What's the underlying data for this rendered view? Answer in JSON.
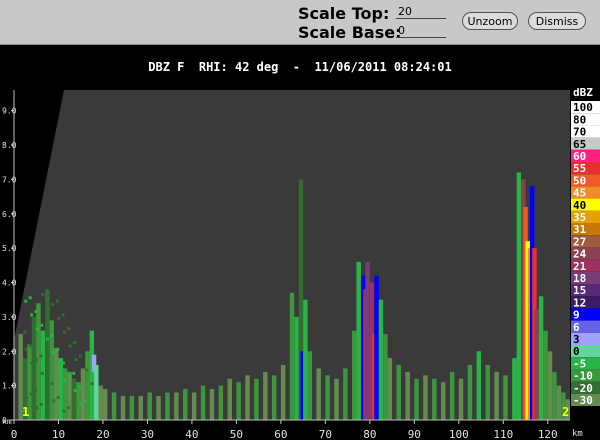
{
  "toolbar": {
    "scale_top_label": "Scale Top:",
    "scale_top_value": "20",
    "scale_base_label": "Scale Base:",
    "scale_base_value": "0",
    "unzoom_label": "Unzoom",
    "dismiss_label": "Dismiss"
  },
  "plot": {
    "title": "DBZ F  RHI: 42 deg  -  11/06/2011 08:24:01",
    "left_marker": "1",
    "right_marker": "2"
  },
  "colors": {
    "background": "#000000",
    "plot_background": "#3a3a3a",
    "toolbar": "#c8c8c8"
  },
  "chart_data": {
    "type": "heatmap",
    "title": "DBZ F  RHI: 42 deg  -  11/06/2011 08:24:01",
    "xlabel": "km",
    "ylabel": "km",
    "xlim": [
      0,
      125
    ],
    "ylim": [
      0,
      9.6
    ],
    "x_ticks": [
      "0",
      "10",
      "20",
      "30",
      "40",
      "50",
      "60",
      "70",
      "80",
      "90",
      "100",
      "110",
      "120"
    ],
    "y_ticks": [
      "0.",
      "1.0",
      "2.0",
      "3.0",
      "4.0",
      "5.0",
      "6.0",
      "7.0",
      "8.0",
      "9.0"
    ],
    "x_unit": "km",
    "y_unit": "km",
    "legend_title": "dBZ",
    "legend_levels": [
      {
        "label": "100",
        "color": "#ffffff"
      },
      {
        "label": "80",
        "color": "#ffffff"
      },
      {
        "label": "70",
        "color": "#ffffff"
      },
      {
        "label": "65",
        "color": "#c8c8c8"
      },
      {
        "label": "60",
        "color": "#ff2080"
      },
      {
        "label": "55",
        "color": "#e83030"
      },
      {
        "label": "50",
        "color": "#f05a28"
      },
      {
        "label": "45",
        "color": "#f08c28"
      },
      {
        "label": "40",
        "color": "#ffff00"
      },
      {
        "label": "35",
        "color": "#e8a000"
      },
      {
        "label": "31",
        "color": "#c87800"
      },
      {
        "label": "27",
        "color": "#a05a3c"
      },
      {
        "label": "24",
        "color": "#8c4050"
      },
      {
        "label": "21",
        "color": "#9c3060"
      },
      {
        "label": "18",
        "color": "#783c78"
      },
      {
        "label": "15",
        "color": "#5a2878"
      },
      {
        "label": "12",
        "color": "#3c1c64"
      },
      {
        "label": "9",
        "color": "#0000ff"
      },
      {
        "label": "6",
        "color": "#6464e6"
      },
      {
        "label": "3",
        "color": "#a0a0ff"
      },
      {
        "label": "0",
        "color": "#64d4a0"
      },
      {
        "label": "-5",
        "color": "#28b446"
      },
      {
        "label": "-10",
        "color": "#3c963c"
      },
      {
        "label": "-20",
        "color": "#326e32"
      },
      {
        "label": "-30",
        "color": "#648c50"
      }
    ],
    "blanking_region": "upper-left",
    "cells": [
      [
        1,
        0,
        2.5,
        "#648c50"
      ],
      [
        2,
        0,
        1.8,
        "#326e32"
      ],
      [
        3,
        0,
        2.2,
        "#3c963c"
      ],
      [
        4,
        0,
        3.0,
        "#326e32"
      ],
      [
        5,
        0,
        3.4,
        "#3c963c"
      ],
      [
        6,
        0,
        2.6,
        "#28b446"
      ],
      [
        7,
        0,
        3.8,
        "#326e32"
      ],
      [
        8,
        0,
        2.9,
        "#3c963c"
      ],
      [
        9,
        0,
        2.1,
        "#648c50"
      ],
      [
        10,
        0,
        1.8,
        "#28b446"
      ],
      [
        11,
        0,
        1.5,
        "#3c963c"
      ],
      [
        12,
        0,
        1.4,
        "#648c50"
      ],
      [
        13,
        0,
        1.2,
        "#326e32"
      ],
      [
        14,
        0,
        1.1,
        "#3c963c"
      ],
      [
        15,
        0,
        1.5,
        "#648c50"
      ],
      [
        16,
        0,
        2.0,
        "#3c963c"
      ],
      [
        17,
        0,
        2.6,
        "#28b446"
      ],
      [
        17.5,
        1.4,
        1.9,
        "#a0a0ff"
      ],
      [
        18,
        0,
        1.6,
        "#64d4a0"
      ],
      [
        19,
        0,
        1.0,
        "#648c50"
      ],
      [
        20,
        0,
        0.9,
        "#648c50"
      ],
      [
        22,
        0,
        0.8,
        "#3c963c"
      ],
      [
        24,
        0,
        0.7,
        "#648c50"
      ],
      [
        26,
        0,
        0.7,
        "#3c963c"
      ],
      [
        28,
        0,
        0.7,
        "#648c50"
      ],
      [
        30,
        0,
        0.8,
        "#3c963c"
      ],
      [
        32,
        0,
        0.7,
        "#648c50"
      ],
      [
        34,
        0,
        0.8,
        "#3c963c"
      ],
      [
        36,
        0,
        0.8,
        "#648c50"
      ],
      [
        38,
        0,
        0.9,
        "#3c963c"
      ],
      [
        40,
        0,
        0.8,
        "#648c50"
      ],
      [
        42,
        0,
        1.0,
        "#3c963c"
      ],
      [
        44,
        0,
        0.9,
        "#648c50"
      ],
      [
        46,
        0,
        1.0,
        "#3c963c"
      ],
      [
        48,
        0,
        1.2,
        "#648c50"
      ],
      [
        50,
        0,
        1.1,
        "#3c963c"
      ],
      [
        52,
        0,
        1.3,
        "#648c50"
      ],
      [
        54,
        0,
        1.2,
        "#3c963c"
      ],
      [
        56,
        0,
        1.4,
        "#648c50"
      ],
      [
        58,
        0,
        1.3,
        "#3c963c"
      ],
      [
        60,
        0,
        1.6,
        "#648c50"
      ],
      [
        62,
        0,
        3.7,
        "#3c963c"
      ],
      [
        63,
        0,
        3.0,
        "#28b446"
      ],
      [
        64,
        0,
        7.0,
        "#326e32"
      ],
      [
        64.4,
        0,
        2.0,
        "#0000ff"
      ],
      [
        65,
        0,
        3.5,
        "#28b446"
      ],
      [
        66,
        0,
        2.0,
        "#3c963c"
      ],
      [
        68,
        0,
        1.5,
        "#648c50"
      ],
      [
        70,
        0,
        1.3,
        "#3c963c"
      ],
      [
        72,
        0,
        1.2,
        "#648c50"
      ],
      [
        74,
        0,
        1.5,
        "#3c963c"
      ],
      [
        76,
        0,
        2.6,
        "#3c963c"
      ],
      [
        77,
        0,
        4.6,
        "#28b446"
      ],
      [
        78,
        0,
        4.2,
        "#0000ff"
      ],
      [
        78.5,
        0,
        3.8,
        "#9c3060"
      ],
      [
        79,
        0,
        4.6,
        "#783c78"
      ],
      [
        80,
        0,
        4.0,
        "#9c3060"
      ],
      [
        80.5,
        0,
        2.5,
        "#e83030"
      ],
      [
        81,
        0,
        4.2,
        "#0000ff"
      ],
      [
        82,
        0,
        3.5,
        "#28b446"
      ],
      [
        83,
        0,
        2.5,
        "#3c963c"
      ],
      [
        84,
        0,
        1.8,
        "#648c50"
      ],
      [
        86,
        0,
        1.6,
        "#3c963c"
      ],
      [
        88,
        0,
        1.4,
        "#648c50"
      ],
      [
        90,
        0,
        1.2,
        "#3c963c"
      ],
      [
        92,
        0,
        1.3,
        "#648c50"
      ],
      [
        94,
        0,
        1.2,
        "#3c963c"
      ],
      [
        96,
        0,
        1.1,
        "#648c50"
      ],
      [
        98,
        0,
        1.4,
        "#3c963c"
      ],
      [
        100,
        0,
        1.2,
        "#648c50"
      ],
      [
        102,
        0,
        1.6,
        "#3c963c"
      ],
      [
        104,
        0,
        2.0,
        "#28b446"
      ],
      [
        106,
        0,
        1.6,
        "#3c963c"
      ],
      [
        108,
        0,
        1.4,
        "#648c50"
      ],
      [
        110,
        0,
        1.3,
        "#3c963c"
      ],
      [
        112,
        0,
        1.8,
        "#28b446"
      ],
      [
        113,
        0,
        7.2,
        "#28b446"
      ],
      [
        114,
        0,
        7.0,
        "#8c4050"
      ],
      [
        114.5,
        0,
        6.2,
        "#f05a28"
      ],
      [
        115,
        0,
        5.2,
        "#ffff00"
      ],
      [
        115.5,
        0,
        5.0,
        "#f08c28"
      ],
      [
        116,
        0,
        6.8,
        "#0000ff"
      ],
      [
        116.5,
        0,
        5.0,
        "#e83030"
      ],
      [
        117,
        0,
        3.2,
        "#8c4050"
      ],
      [
        118,
        0,
        3.6,
        "#28b446"
      ],
      [
        119,
        0,
        2.6,
        "#3c963c"
      ],
      [
        120,
        0,
        2.0,
        "#648c50"
      ],
      [
        121,
        0,
        1.4,
        "#3c963c"
      ],
      [
        122,
        0,
        1.0,
        "#648c50"
      ],
      [
        123,
        0,
        0.8,
        "#3c963c"
      ],
      [
        124,
        0,
        0.6,
        "#648c50"
      ]
    ]
  }
}
